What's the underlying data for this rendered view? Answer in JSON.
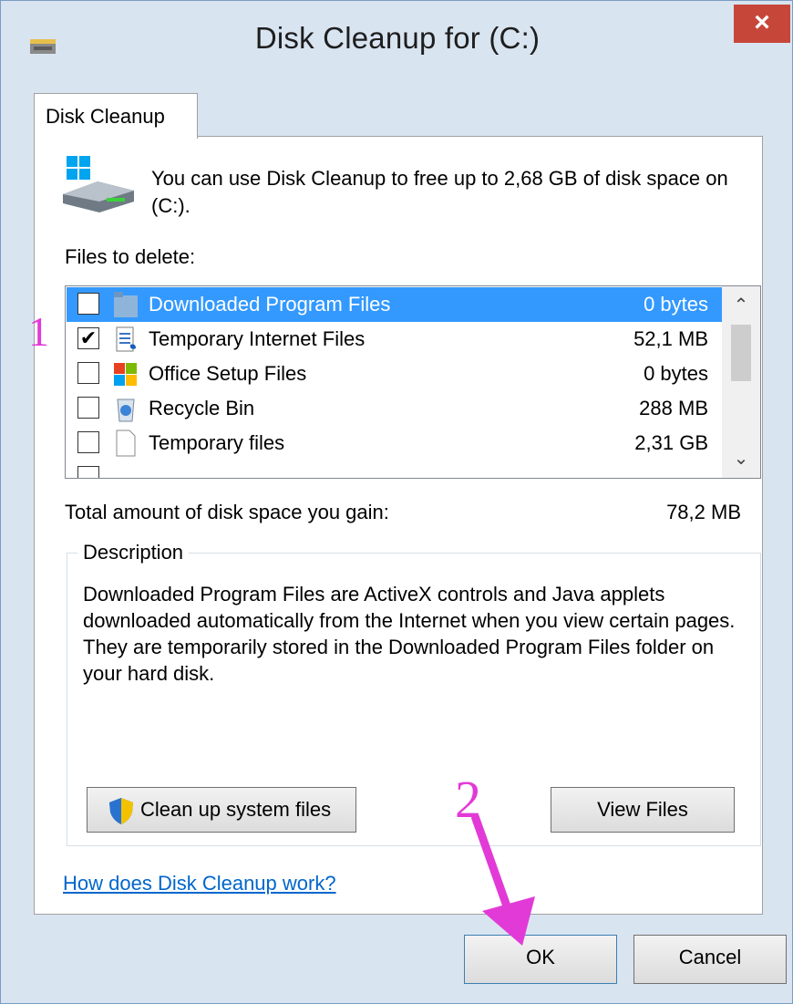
{
  "window": {
    "title": "Disk Cleanup for  (C:)",
    "close_glyph": "×"
  },
  "tab": {
    "label": "Disk Cleanup"
  },
  "intro": {
    "text": "You can use Disk Cleanup to free up to 2,68 GB of disk space on  (C:)."
  },
  "files": {
    "label": "Files to delete:",
    "items": [
      {
        "name": "Downloaded Program Files",
        "size": "0 bytes",
        "checked": false,
        "selected": true,
        "icon": "folder-icon"
      },
      {
        "name": "Temporary Internet Files",
        "size": "52,1 MB",
        "checked": true,
        "selected": false,
        "icon": "document-icon"
      },
      {
        "name": "Office Setup Files",
        "size": "0 bytes",
        "checked": false,
        "selected": false,
        "icon": "office-icon"
      },
      {
        "name": "Recycle Bin",
        "size": "288 MB",
        "checked": false,
        "selected": false,
        "icon": "recycle-bin-icon"
      },
      {
        "name": "Temporary files",
        "size": "2,31 GB",
        "checked": false,
        "selected": false,
        "icon": "blank-file-icon"
      }
    ],
    "check_glyph": "✔"
  },
  "total": {
    "label": "Total amount of disk space you gain:",
    "value": "78,2 MB"
  },
  "description": {
    "legend": "Description",
    "text": "Downloaded Program Files are ActiveX controls and Java applets downloaded automatically from the Internet when you view certain pages. They are temporarily stored in the Downloaded Program Files folder on your hard disk."
  },
  "buttons": {
    "cleanup": "Clean up system files",
    "view_files": "View Files",
    "ok": "OK",
    "cancel": "Cancel"
  },
  "help_link": "How does Disk Cleanup work?",
  "annotations": {
    "one": "1",
    "two": "2"
  },
  "colors": {
    "selection": "#3399ff",
    "annotation": "#e23ad6",
    "close": "#c7463a",
    "link": "#0066cc"
  }
}
